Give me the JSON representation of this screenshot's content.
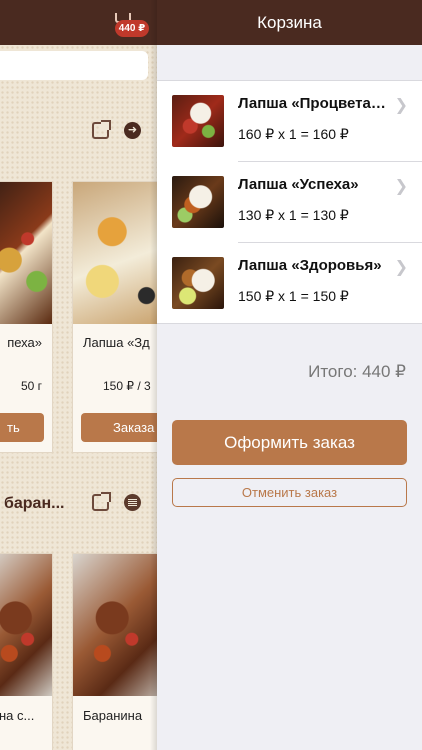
{
  "menu_panel": {
    "cart_badge": "440 ₽",
    "section1": {
      "cards": [
        {
          "name": "пеха»",
          "price": "50 г",
          "order_label": "ть"
        },
        {
          "name": "Лапша «Зд",
          "price": "150 ₽ / 3",
          "order_label": "Заказа"
        }
      ]
    },
    "section2": {
      "title": "баран...",
      "cards": [
        {
          "name": "на с..."
        },
        {
          "name": "Баранина"
        }
      ]
    }
  },
  "cart": {
    "title": "Корзина",
    "items": [
      {
        "name": "Лапша «Процветания»",
        "calc": "160 ₽ x 1 = 160 ₽",
        "thumb": "noodle-box-red"
      },
      {
        "name": "Лапша «Успеха»",
        "calc": "130 ₽ x 1 = 130 ₽",
        "thumb": "noodle-box-brown"
      },
      {
        "name": "Лапша «Здоровья»",
        "calc": "150 ₽ x 1 = 150 ₽",
        "thumb": "noodle-box-lime"
      }
    ],
    "total": "Итого: 440 ₽",
    "order_button": "Оформить заказ",
    "cancel_button": "Отменить заказ"
  },
  "colors": {
    "header": "#4a2a20",
    "accent": "#b9784a",
    "badge": "#c0392b"
  }
}
